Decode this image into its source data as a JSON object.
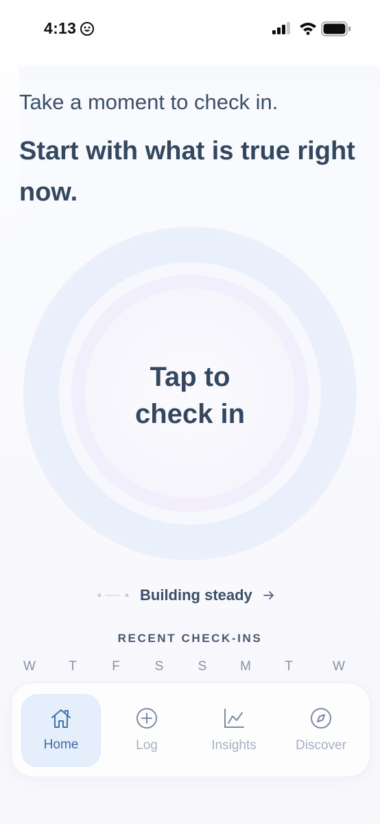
{
  "status_bar": {
    "time": "4:13"
  },
  "intro": "Take a moment to check in.",
  "heading": "Start with what is true right now.",
  "checkin": {
    "label_line1": "Tap to",
    "label_line2": "check in"
  },
  "streak": {
    "label": "Building steady"
  },
  "recent": {
    "title": "RECENT CHECK-INS",
    "days": [
      "W",
      "T",
      "F",
      "S",
      "S",
      "M",
      "T",
      "W"
    ]
  },
  "tabs": [
    {
      "label": "Home",
      "icon": "home-icon",
      "active": true
    },
    {
      "label": "Log",
      "icon": "plus-circle-icon",
      "active": false
    },
    {
      "label": "Insights",
      "icon": "chart-icon",
      "active": false
    },
    {
      "label": "Discover",
      "icon": "compass-icon",
      "active": false
    }
  ],
  "colors": {
    "text": "#34475f",
    "active_tab": "#3f6aa4",
    "active_tab_bg": "#e4effb",
    "muted": "#a6b1c2"
  }
}
